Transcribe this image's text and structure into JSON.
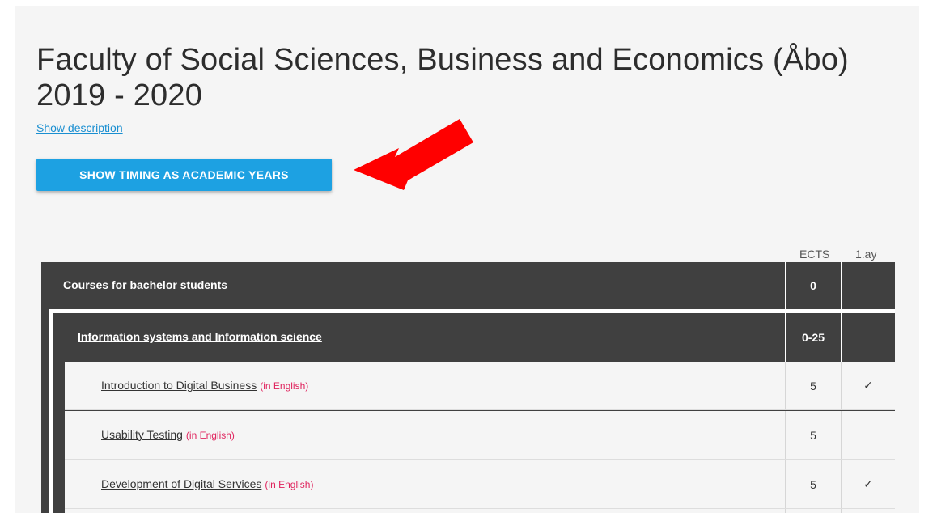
{
  "page": {
    "title_line1": "Faculty of Social Sciences, Business and Economics (Åbo)",
    "title_line2": "2019 - 2020",
    "show_description": "Show description",
    "timing_button": "SHOW TIMING AS ACADEMIC YEARS"
  },
  "table": {
    "headers": {
      "ects": "ECTS",
      "ay": "1.ay"
    },
    "groups": [
      {
        "label": "Courses for bachelor students",
        "ects": "0",
        "ay": ""
      },
      {
        "label": "Information systems and Information science",
        "ects": "0-25",
        "ay": ""
      }
    ],
    "courses": [
      {
        "label": "Introduction to Digital Business",
        "lang": "(in English)",
        "ects": "5",
        "ay": "✓"
      },
      {
        "label": "Usability Testing",
        "lang": "(in English)",
        "ects": "5",
        "ay": ""
      },
      {
        "label": "Development of Digital Services",
        "lang": "(in English)",
        "ects": "5",
        "ay": "✓"
      }
    ]
  },
  "colors": {
    "button": "#1da1e2",
    "link": "#1a8fd1",
    "group_row": "#404040",
    "language_tag": "#e0245e",
    "annotation_arrow": "#ff0000"
  },
  "icons": {
    "annotation": "red-arrow-icon",
    "check": "checkmark-icon"
  }
}
